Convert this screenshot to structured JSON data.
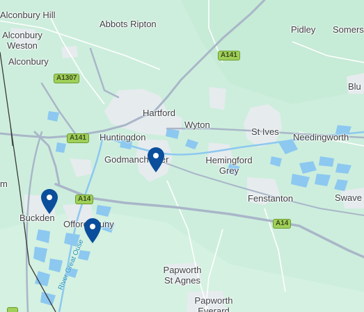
{
  "map": {
    "places": {
      "alconbury_hill": "Alconbury Hill",
      "abbots_ripton": "Abbots Ripton",
      "pidley": "Pidley",
      "somersham": "Somers",
      "alconbury_weston_1": "Alconbury",
      "alconbury_weston_2": "Weston",
      "alconbury": "Alconbury",
      "bluntisham": "Blu",
      "hartford": "Hartford",
      "wyton": "Wyton",
      "st_ives": "St Ives",
      "needingworth": "Needingworth",
      "huntingdon": "Huntingdon",
      "godmanchester": "Godmanchester",
      "hemingford_grey_1": "Hemingford",
      "hemingford_grey_2": "Grey",
      "fenstanton": "Fenstanton",
      "swavesey": "Swave",
      "buckden": "Buckden",
      "offord_cluny": "Offord Cluny",
      "papworth_st_agnes_1": "Papworth",
      "papworth_st_agnes_2": "St Agnes",
      "papworth_everard_1": "Papworth",
      "papworth_everard_2": "Everard",
      "left_edge": "m"
    },
    "roads": {
      "a141_north": "A141",
      "a1307": "A1307",
      "a141_west": "A141",
      "a14_west": "A14",
      "a14_east": "A14"
    },
    "river": "River Great Ouse",
    "markers": [
      {
        "name": "Godmanchester marker"
      },
      {
        "name": "Buckden marker"
      },
      {
        "name": "Offord Cluny marker"
      }
    ],
    "colors": {
      "land": "#cdeedd",
      "urban": "#e8ecef",
      "water": "#8cc8f0",
      "road": "#a9b6c8",
      "pin": "#0b4e9b"
    }
  }
}
